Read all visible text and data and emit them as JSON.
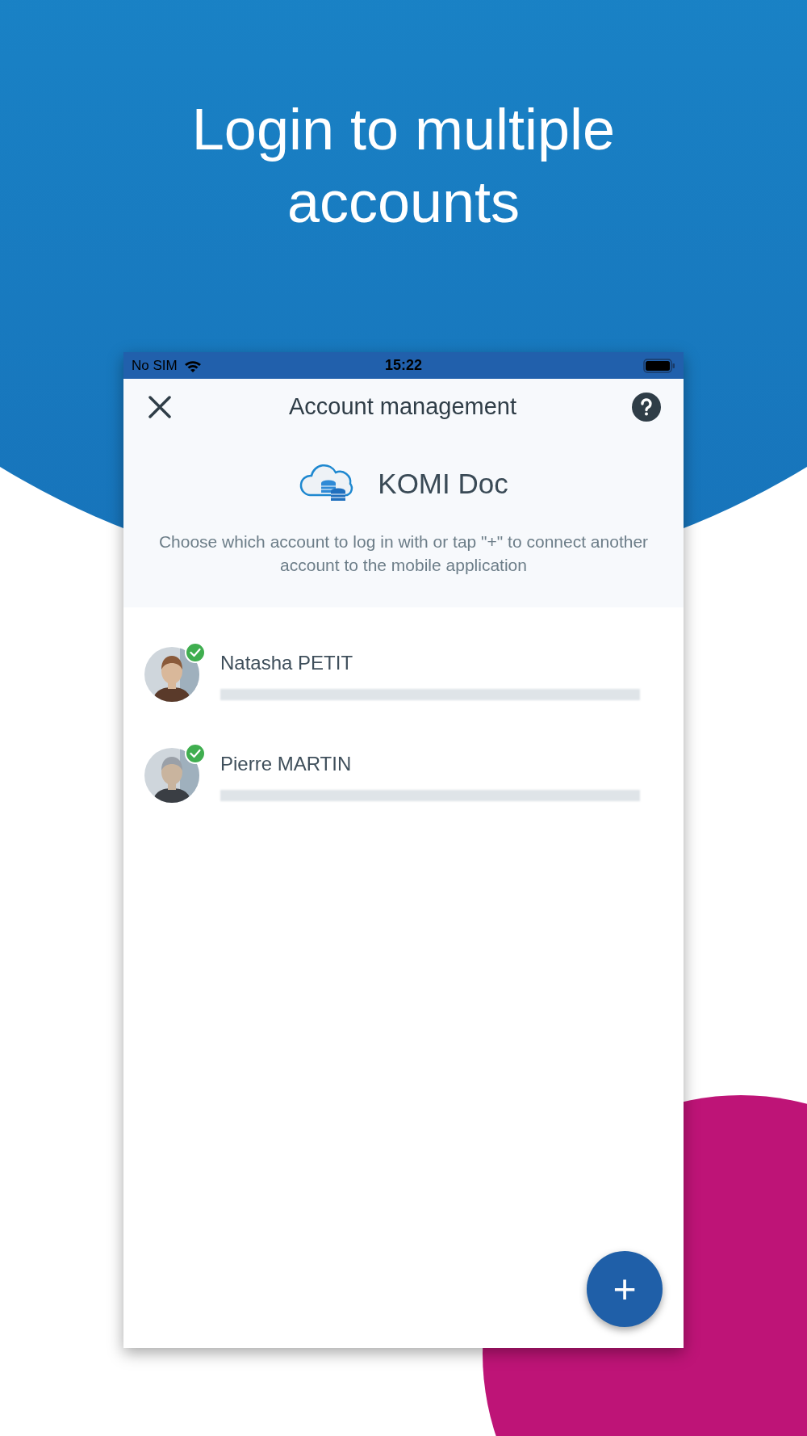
{
  "headline": [
    "Login to multiple",
    "accounts"
  ],
  "status_bar": {
    "carrier": "No SIM",
    "time": "15:22"
  },
  "header": {
    "title": "Account management"
  },
  "app": {
    "name": "KOMI Doc"
  },
  "description": "Choose which account to log in with or tap \"+\" to connect another account to the mobile application",
  "accounts": [
    {
      "name": "Natasha PETIT",
      "connected": true
    },
    {
      "name": "Pierre MARTIN",
      "connected": true
    }
  ],
  "fab": {
    "label": "+"
  }
}
